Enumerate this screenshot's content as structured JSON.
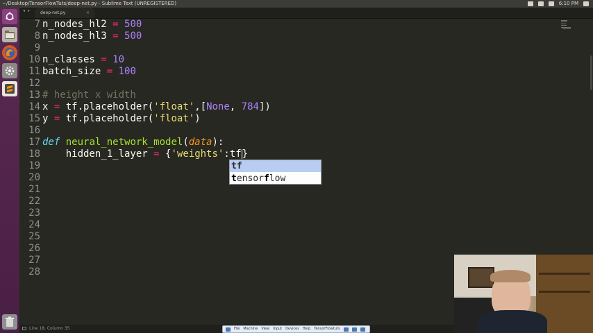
{
  "window": {
    "title": "~/Desktop/TensorFlowTuts/deep-net.py - Sublime Text (UNREGISTERED)",
    "clock": "6:10 PM"
  },
  "tab": {
    "filename": "deep-net.py",
    "nav": "◂ ▸",
    "close": "×"
  },
  "editor": {
    "line_numbers": [
      "7",
      "8",
      "9",
      "10",
      "11",
      "12",
      "13",
      "14",
      "15",
      "16",
      "17",
      "18",
      "19",
      "20",
      "21",
      "22",
      "23",
      "24",
      "25",
      "26",
      "27",
      "28"
    ],
    "code": [
      {
        "var": "n_nodes_hl2",
        "sp": " ",
        "op": "=",
        "sp2": " ",
        "num": "500"
      },
      {
        "var": "n_nodes_hl3",
        "sp": " ",
        "op": "=",
        "sp2": " ",
        "num": "500"
      },
      {},
      {
        "var": "n_classes",
        "sp": " ",
        "op": "=",
        "sp2": " ",
        "num": "10"
      },
      {
        "var": "batch_size",
        "sp": " ",
        "op": "=",
        "sp2": " ",
        "num": "100"
      },
      {},
      {
        "comment": "# height x width"
      },
      {
        "var": "x",
        "sp": " ",
        "op": "=",
        "sp2": " ",
        "call": "tf.placeholder(",
        "str": "'float'",
        "mid": ",[",
        "const": "None",
        "mid2": ", ",
        "num": "784",
        "end": "])"
      },
      {
        "var": "y",
        "sp": " ",
        "op": "=",
        "sp2": " ",
        "call": "tf.placeholder(",
        "str": "'float'",
        "end": ")"
      },
      {},
      {
        "kw": "def",
        "sp": " ",
        "fn": "neural_network_model",
        "open": "(",
        "param": "data",
        "end": "):"
      },
      {
        "indent": "    ",
        "var": "hidden_1_layer",
        "sp": " ",
        "op": "=",
        "sp2": " ",
        "open": "{",
        "str": "'weights'",
        "mid": ":tf",
        "end": "}"
      }
    ]
  },
  "autocomplete": {
    "items": [
      {
        "match": "tf",
        "rest": ""
      },
      {
        "parts": [
          "t",
          "ensor",
          "f",
          "low"
        ]
      }
    ]
  },
  "status": {
    "text": "Line 18, Column 35"
  },
  "vm_toolbar": {
    "items": [
      "File",
      "Machine",
      "View",
      "Input",
      "Devices",
      "Help",
      "TensorFlowtuts"
    ]
  },
  "colors": {
    "background": "#272822",
    "keyword": "#66d9ef",
    "function": "#a6e22e",
    "operator": "#f92672",
    "number": "#ae81ff",
    "string": "#e6db74",
    "comment": "#75715e",
    "parameter": "#fd971f",
    "launcher": "#5a2a52",
    "autocomplete_selected": "#b9cdf2"
  },
  "icons": {
    "launcher": [
      "ubuntu-dash-icon",
      "files-icon",
      "firefox-icon",
      "settings-icon",
      "sublime-text-icon",
      "trash-icon"
    ],
    "tray": [
      "network-icon",
      "keyboard-icon",
      "volume-icon",
      "settings-cog-icon"
    ]
  }
}
